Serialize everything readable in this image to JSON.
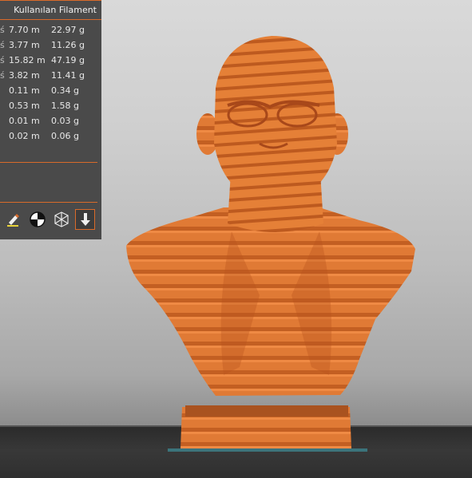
{
  "panel": {
    "header": "Kullanılan Filament",
    "rows": [
      {
        "marker": "ś",
        "length": "7.70 m",
        "weight": "22.97 g"
      },
      {
        "marker": "ś",
        "length": "3.77 m",
        "weight": "11.26 g"
      },
      {
        "marker": "ś",
        "length": "15.82 m",
        "weight": "47.19 g"
      },
      {
        "marker": "ś",
        "length": "3.82 m",
        "weight": "11.41 g"
      },
      {
        "marker": "",
        "length": "0.11 m",
        "weight": "0.34 g"
      },
      {
        "marker": "",
        "length": "0.53 m",
        "weight": "1.58 g"
      },
      {
        "marker": "",
        "length": "0.01 m",
        "weight": "0.03 g"
      },
      {
        "marker": "",
        "length": "0.02 m",
        "weight": "0.06 g"
      }
    ],
    "tools": [
      {
        "icon": "paint-brush-icon"
      },
      {
        "icon": "center-of-mass-icon"
      },
      {
        "icon": "wireframe-cube-icon"
      },
      {
        "icon": "arrow-down-icon",
        "active": true
      }
    ]
  },
  "colors": {
    "accent": "#d86a2a",
    "model": "#e07a35",
    "model_dark": "#b8541c",
    "panel": "#4a4a4a"
  }
}
